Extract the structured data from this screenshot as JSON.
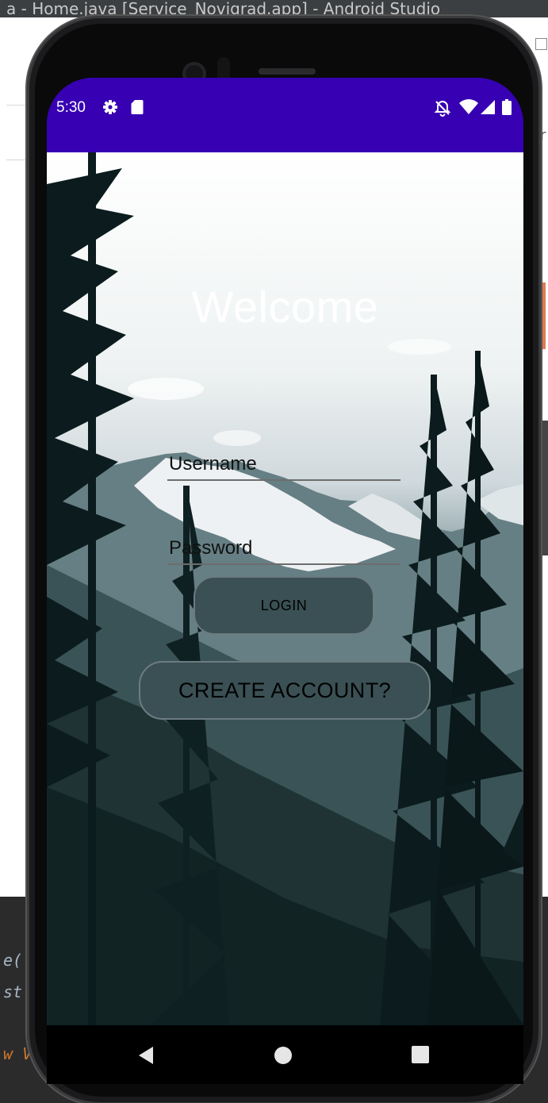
{
  "ide": {
    "title_text": "a - Home.java [Service_Novigrad.app] - Android Studio",
    "code_lines": [
      "e(",
      "st",
      "w V"
    ]
  },
  "status_bar": {
    "time": "5:30",
    "left_icons": [
      "gear-icon",
      "sd-card-icon"
    ],
    "right_icons": [
      "notifications-off-icon",
      "wifi-icon",
      "cellular-icon",
      "battery-icon"
    ],
    "color": "#3700b3"
  },
  "login_screen": {
    "title": "Welcome",
    "username_placeholder": "Username",
    "password_placeholder": "Password",
    "login_label": "LOGIN",
    "create_account_label": "CREATE ACCOUNT?"
  },
  "nav_bar": {
    "buttons": [
      "back-icon",
      "home-icon",
      "recents-icon"
    ]
  },
  "colors": {
    "button_fill": "#3a5054",
    "button_border": "#6c7c80",
    "title_text": "#ffffff"
  }
}
